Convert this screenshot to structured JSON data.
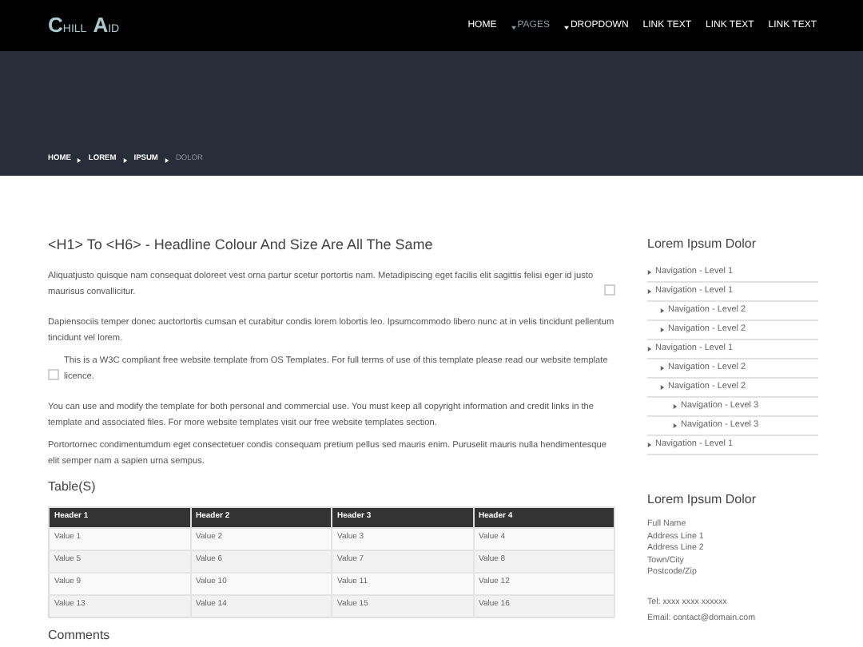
{
  "logo": [
    "C",
    "HILL",
    "A",
    "ID"
  ],
  "nav": [
    {
      "label": "HOME",
      "selected": false,
      "dropdown": false
    },
    {
      "label": "PAGES",
      "selected": true,
      "dropdown": true
    },
    {
      "label": "DROPDOWN",
      "selected": false,
      "dropdown": true
    },
    {
      "label": "LINK TEXT",
      "selected": false,
      "dropdown": false
    },
    {
      "label": "LINK TEXT",
      "selected": false,
      "dropdown": false
    },
    {
      "label": "LINK TEXT",
      "selected": false,
      "dropdown": false
    }
  ],
  "breadcrumb": [
    {
      "label": "HOME",
      "selected": false
    },
    {
      "label": "LOREM",
      "selected": false
    },
    {
      "label": "IPSUM",
      "selected": false
    },
    {
      "label": "DOLOR",
      "selected": true
    }
  ],
  "heading": "<H1> To <H6> - Headline Colour And Size Are All The Same",
  "paragraphs": [
    {
      "text": "Aliquatjusto quisque nam consequat doloreet vest orna partur scetur portortis nam. Metadipiscing eget facilis elit sagittis felisi eger id justo maurisus convallicitur.",
      "kind": "image_right"
    },
    {
      "text": "Dapiensociis temper donec auctortortis cumsan et curabitur condis lorem lobortis leo. Ipsumcommodo libero nunc at in velis tincidunt pellentum tincidunt vel lorem.",
      "kind": "plain"
    },
    {
      "text": "This is a W3C compliant free website template from OS Templates. For full terms of use of this template please read our website template licence.",
      "kind": "image_left"
    },
    {
      "text": "You can use and modify the template for both personal and commercial use. You must keep all copyright information and credit links in the template and associated files. For more website templates visit our free website templates section.",
      "kind": "plain"
    },
    {
      "text": "Portortornec condimentumdum eget consectetuer condis consequam pretium pellus sed mauris enim. Puruselit mauris nulla hendimentesque elit semper nam a sapien urna sempus.",
      "kind": "plain"
    }
  ],
  "table_title": "Table(S)",
  "table": {
    "columns": [
      "Header 1",
      "Header 2",
      "Header 3",
      "Header 4"
    ],
    "rows": [
      [
        "Value 1",
        "Value 2",
        "Value 3",
        "Value 4"
      ],
      [
        "Value 5",
        "Value 6",
        "Value 7",
        "Value 8"
      ],
      [
        "Value 9",
        "Value 10",
        "Value 11",
        "Value 12"
      ],
      [
        "Value 13",
        "Value 14",
        "Value 15",
        "Value 16"
      ]
    ]
  },
  "comments_title": "Comments",
  "sidebar": {
    "nav_title": "Lorem Ipsum Dolor",
    "nav": [
      {
        "label": "Navigation - Level 1"
      },
      {
        "label": "Navigation - Level 1",
        "children": [
          {
            "label": "Navigation - Level 2"
          },
          {
            "label": "Navigation - Level 2"
          }
        ]
      },
      {
        "label": "Navigation - Level 1",
        "children": [
          {
            "label": "Navigation - Level 2"
          },
          {
            "label": "Navigation - Level 2",
            "children": [
              {
                "label": "Navigation - Level 3"
              },
              {
                "label": "Navigation - Level 3"
              }
            ]
          }
        ]
      },
      {
        "label": "Navigation - Level 1"
      }
    ],
    "address_title": "Lorem Ipsum Dolor",
    "address": [
      "Full Name",
      "Address Line 1",
      "Address Line 2",
      "Town/City",
      "Postcode/Zip"
    ],
    "contact": [
      "Tel: xxxx xxxx xxxxxx",
      "Email: contact@domain.com"
    ]
  }
}
